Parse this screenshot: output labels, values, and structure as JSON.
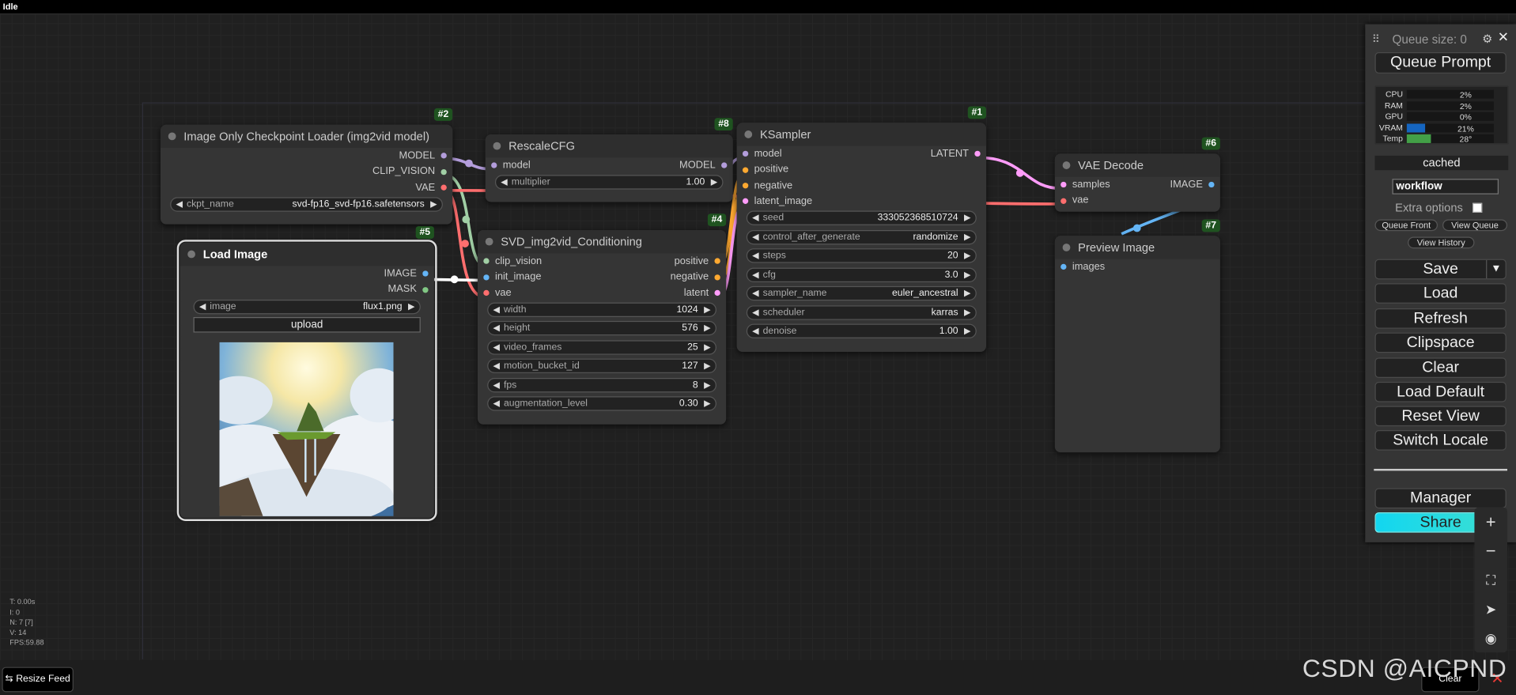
{
  "status": "Idle",
  "nodes": {
    "ckpt": {
      "id": "#2",
      "title": "Image Only Checkpoint Loader (img2vid model)",
      "outputs": [
        "MODEL",
        "CLIP_VISION",
        "VAE"
      ],
      "widget_label": "ckpt_name",
      "widget_value": "svd-fp16_svd-fp16.safetensors"
    },
    "load": {
      "id": "#5",
      "title": "Load Image",
      "outputs": [
        "IMAGE",
        "MASK"
      ],
      "widget_label": "image",
      "widget_value": "flux1.png",
      "upload": "upload"
    },
    "rescale": {
      "id": "#8",
      "title": "RescaleCFG",
      "input": "model",
      "output": "MODEL",
      "widget_label": "multiplier",
      "widget_value": "1.00"
    },
    "svd": {
      "id": "#4",
      "title": "SVD_img2vid_Conditioning",
      "inputs": [
        "clip_vision",
        "init_image",
        "vae"
      ],
      "outputs": [
        "positive",
        "negative",
        "latent"
      ],
      "widgets": [
        {
          "label": "width",
          "value": "1024"
        },
        {
          "label": "height",
          "value": "576"
        },
        {
          "label": "video_frames",
          "value": "25"
        },
        {
          "label": "motion_bucket_id",
          "value": "127"
        },
        {
          "label": "fps",
          "value": "8"
        },
        {
          "label": "augmentation_level",
          "value": "0.30"
        }
      ]
    },
    "ksampler": {
      "id": "#1",
      "title": "KSampler",
      "inputs": [
        "model",
        "positive",
        "negative",
        "latent_image"
      ],
      "output": "LATENT",
      "widgets": [
        {
          "label": "seed",
          "value": "333052368510724"
        },
        {
          "label": "control_after_generate",
          "value": "randomize"
        },
        {
          "label": "steps",
          "value": "20"
        },
        {
          "label": "cfg",
          "value": "3.0"
        },
        {
          "label": "sampler_name",
          "value": "euler_ancestral"
        },
        {
          "label": "scheduler",
          "value": "karras"
        },
        {
          "label": "denoise",
          "value": "1.00"
        }
      ]
    },
    "vae": {
      "id": "#6",
      "title": "VAE Decode",
      "inputs": [
        "samples",
        "vae"
      ],
      "output": "IMAGE"
    },
    "preview": {
      "id": "#7",
      "title": "Preview Image",
      "input": "images"
    }
  },
  "panel": {
    "queue_size": "Queue size: 0",
    "queue_prompt": "Queue Prompt",
    "monitor": [
      {
        "k": "CPU",
        "p": "2%",
        "v": 2,
        "color": ""
      },
      {
        "k": "RAM",
        "p": "2%",
        "v": 2,
        "color": ""
      },
      {
        "k": "GPU",
        "p": "0%",
        "v": 0,
        "color": ""
      },
      {
        "k": "VRAM",
        "p": "21%",
        "v": 21,
        "color": "#1565c0"
      },
      {
        "k": "Temp",
        "p": "28°",
        "v": 28,
        "color": "#43a047"
      }
    ],
    "cached": "cached",
    "workflow": "workflow",
    "extra_options": "Extra options",
    "queue_front": "Queue Front",
    "view_queue": "View Queue",
    "view_history": "View History",
    "save": "Save",
    "load": "Load",
    "refresh": "Refresh",
    "clipspace": "Clipspace",
    "clear": "Clear",
    "load_default": "Load Default",
    "reset_view": "Reset View",
    "switch_locale": "Switch Locale",
    "manager": "Manager",
    "share": "Share"
  },
  "stats": [
    "T: 0.00s",
    "I: 0",
    "N: 7 [7]",
    "V: 14",
    "FPS:59.88"
  ],
  "resize_feed": "Resize Feed",
  "clear_bottom": "Clear",
  "watermark": "CSDN @AICPND",
  "colors": {
    "model": "#b39ddb",
    "clip_vision": "#a1cfa5",
    "vae": "#ff6e6e",
    "image": "#64b5f6",
    "mask": "#81c784",
    "conditioning": "#ffa931",
    "latent": "#ff9cf9"
  }
}
